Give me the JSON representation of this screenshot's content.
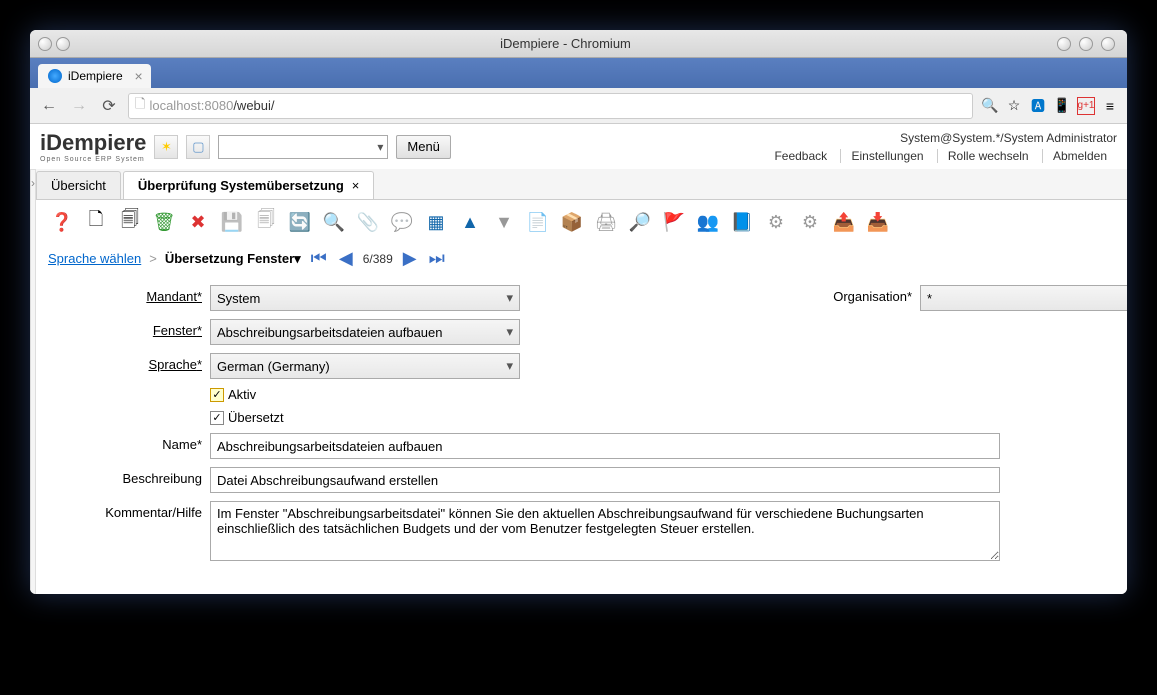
{
  "window": {
    "title": "iDempiere - Chromium"
  },
  "browser": {
    "tab_title": "iDempiere",
    "url_host": "localhost",
    "url_port": ":8080",
    "url_path": "/webui/"
  },
  "header": {
    "logo_main": "iDempiere",
    "logo_sub": "Open Source  ERP System",
    "menu_button": "Menü",
    "context": "System@System.*/System Administrator",
    "links": {
      "feedback": "Feedback",
      "settings": "Einstellungen",
      "switch_role": "Rolle wechseln",
      "logout": "Abmelden"
    }
  },
  "tabs": {
    "overview": "Übersicht",
    "active": "Überprüfung Systemübersetzung"
  },
  "breadcrumb": {
    "link": "Sprache wählen",
    "current": "Übersetzung Fenster",
    "page_info": "6/389"
  },
  "form": {
    "labels": {
      "mandant": "Mandant",
      "organisation": "Organisation",
      "fenster": "Fenster",
      "sprache": "Sprache",
      "aktiv": "Aktiv",
      "uebersetzt": "Übersetzt",
      "name": "Name",
      "beschreibung": "Beschreibung",
      "kommentar": "Kommentar/Hilfe"
    },
    "values": {
      "mandant": "System",
      "organisation": "*",
      "fenster": "Abschreibungsarbeitsdateien aufbauen",
      "sprache": "German (Germany)",
      "aktiv": true,
      "uebersetzt": true,
      "name": "Abschreibungsarbeitsdateien aufbauen",
      "beschreibung": "Datei Abschreibungsaufwand erstellen",
      "kommentar": "Im Fenster \"Abschreibungsarbeitsdatei\" können Sie den aktuellen Abschreibungsaufwand für verschiedene Buchungsarten einschließlich des tatsächlichen Budgets und der vom Benutzer festgelegten Steuer erstellen."
    }
  }
}
